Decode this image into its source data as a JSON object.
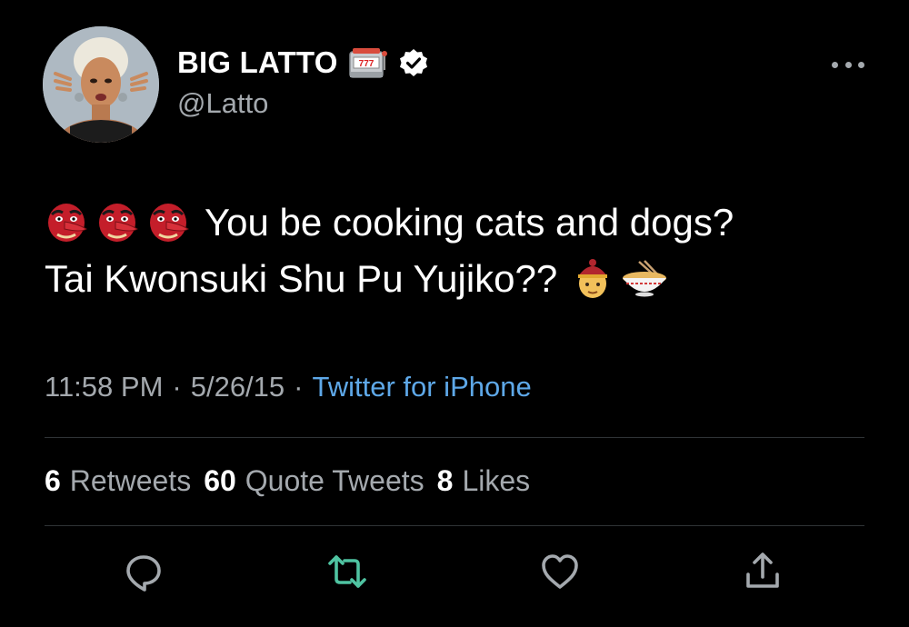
{
  "author": {
    "display_name": "BIG LATTO",
    "handle": "@Latto",
    "badge_icon": "slot-machine-icon",
    "verified_icon": "verified-icon"
  },
  "tweet": {
    "line1_prefix_emojis": [
      "goblin-emoji",
      "goblin-emoji",
      "goblin-emoji"
    ],
    "line1_text": "You be cooking cats and dogs?",
    "line2_text": "Tai Kwonsuki Shu Pu Yujiko??",
    "line2_suffix_emojis": [
      "man-with-skullcap-emoji",
      "steaming-bowl-emoji"
    ]
  },
  "meta": {
    "time": "11:58 PM",
    "sep1": "·",
    "date": "5/26/15",
    "sep2": "·",
    "source": "Twitter for iPhone"
  },
  "stats": {
    "retweets_count": "6",
    "retweets_label": "Retweets",
    "quotes_count": "60",
    "quotes_label": "Quote Tweets",
    "likes_count": "8",
    "likes_label": "Likes"
  },
  "actions": [
    "reply-icon",
    "retweet-icon",
    "like-icon",
    "share-icon"
  ],
  "colors": {
    "background": "#000000",
    "text_primary": "#ffffff",
    "text_secondary": "#a4a9ae",
    "link": "#5ea8e8",
    "retweet_green": "#4fc3a1",
    "divider": "#2f3336"
  }
}
